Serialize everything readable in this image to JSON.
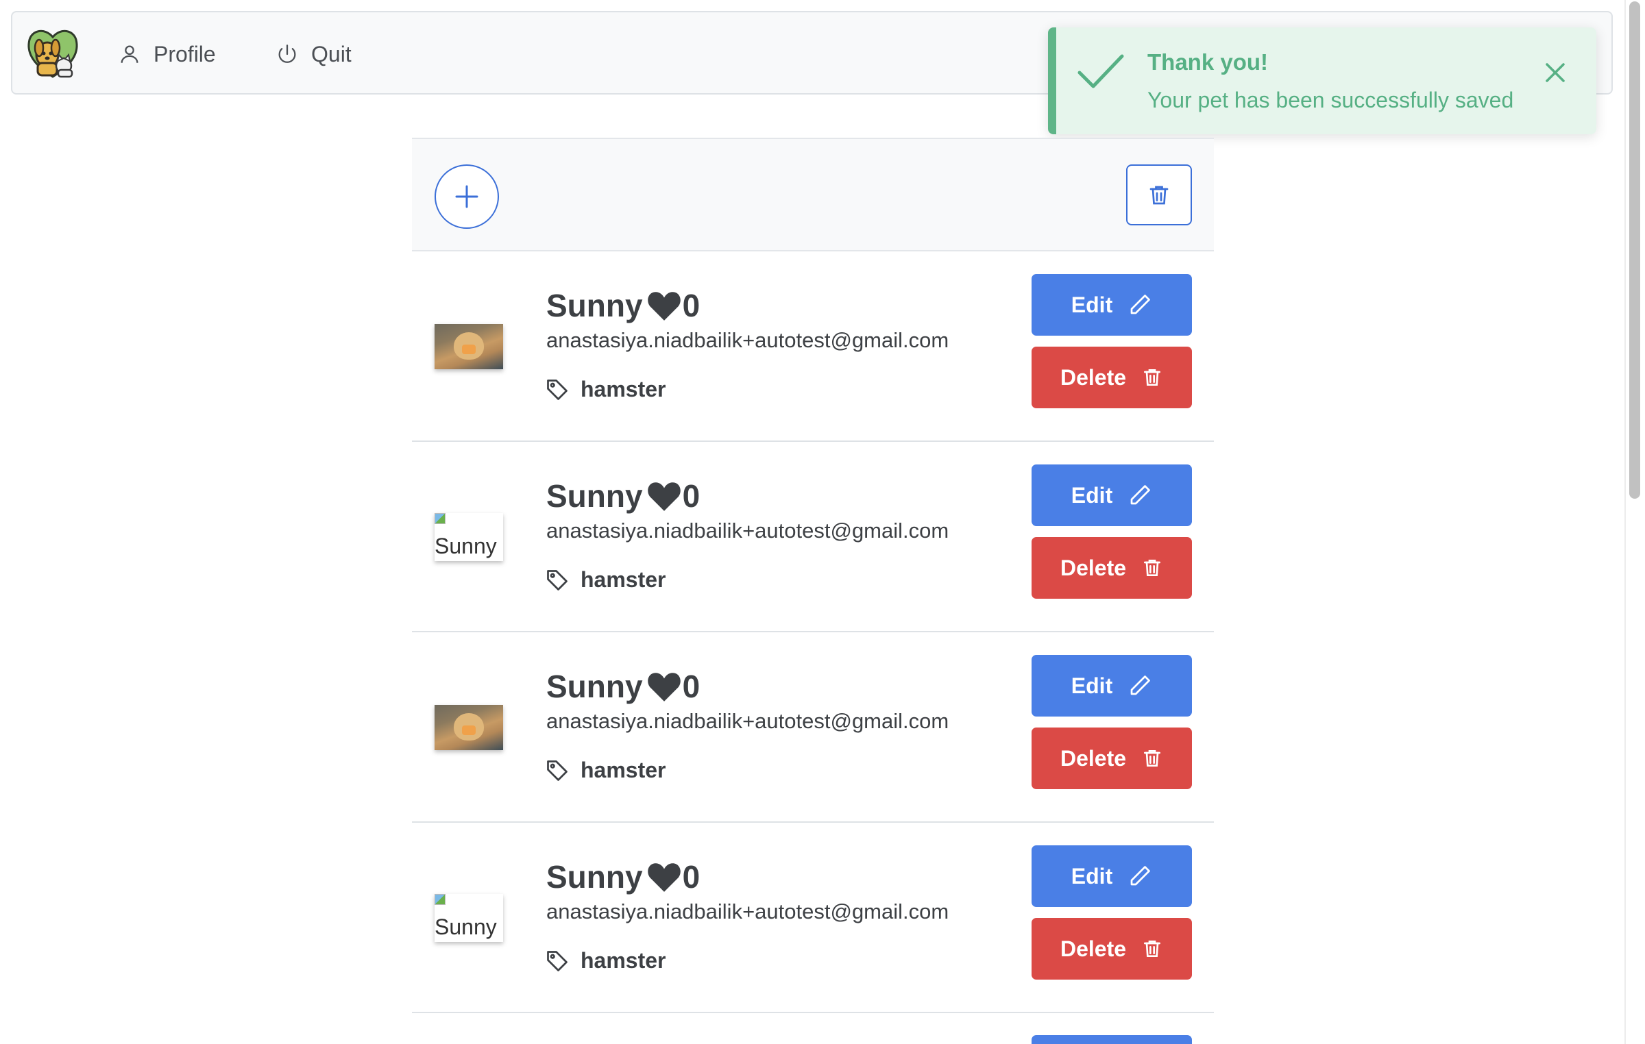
{
  "nav": {
    "logo_icon": "pets-logo-icon",
    "profile_label": "Profile",
    "profile_icon": "person-icon",
    "quit_label": "Quit",
    "quit_icon": "power-icon"
  },
  "toast": {
    "title": "Thank you!",
    "message": "Your pet has been successfully saved",
    "icon": "checkmark-icon",
    "close_icon": "close-icon",
    "accent_color": "#56b084"
  },
  "toolbar": {
    "add_icon": "plus-icon",
    "delete_all_icon": "trash-icon"
  },
  "colors": {
    "primary": "#4a7fe6",
    "danger": "#db4a46",
    "text": "#3d4044"
  },
  "pets": [
    {
      "name": "Sunny",
      "likes": "0",
      "email": "anastasiya.niadbailik+autotest@gmail.com",
      "tag": "hamster",
      "image_alt": "Sunny",
      "image_loaded": true,
      "edit_label": "Edit",
      "delete_label": "Delete"
    },
    {
      "name": "Sunny",
      "likes": "0",
      "email": "anastasiya.niadbailik+autotest@gmail.com",
      "tag": "hamster",
      "image_alt": "Sunny",
      "image_loaded": false,
      "edit_label": "Edit",
      "delete_label": "Delete"
    },
    {
      "name": "Sunny",
      "likes": "0",
      "email": "anastasiya.niadbailik+autotest@gmail.com",
      "tag": "hamster",
      "image_alt": "Sunny",
      "image_loaded": true,
      "edit_label": "Edit",
      "delete_label": "Delete"
    },
    {
      "name": "Sunny",
      "likes": "0",
      "email": "anastasiya.niadbailik+autotest@gmail.com",
      "tag": "hamster",
      "image_alt": "Sunny",
      "image_loaded": false,
      "edit_label": "Edit",
      "delete_label": "Delete"
    }
  ]
}
